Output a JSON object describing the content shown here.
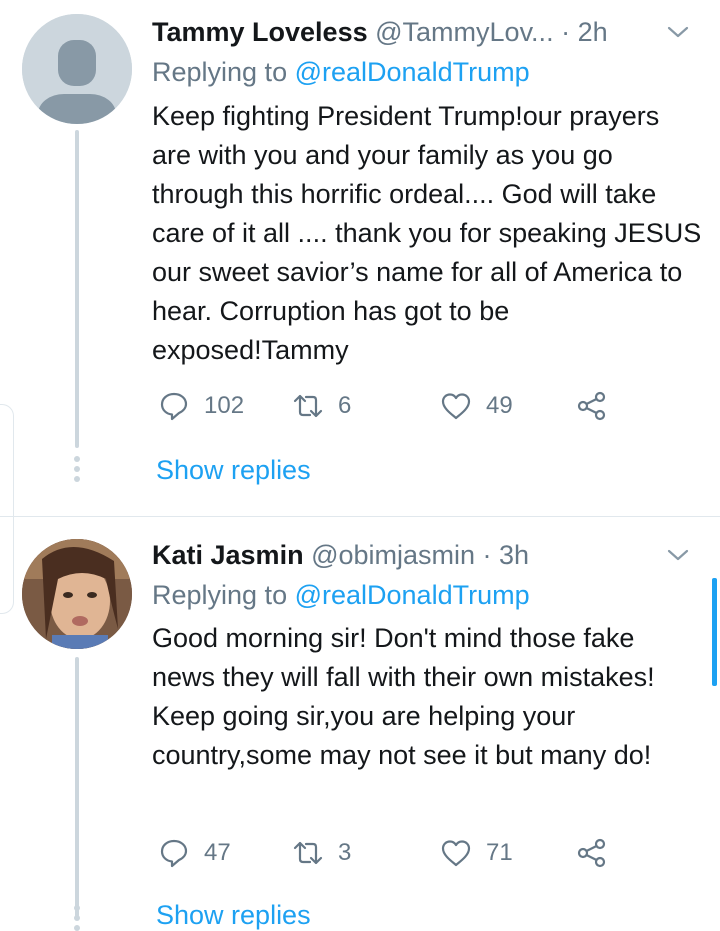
{
  "tweets": [
    {
      "name": "Tammy Loveless",
      "handle": "@TammyLov...",
      "time": "· 2h",
      "replying_prefix": "Replying to ",
      "replying_to": "@realDonaldTrump",
      "text": "Keep fighting President Trump!our prayers are with you and your family as you go through this horrific ordeal.... God will take care of it all .... thank you for speaking JESUS our sweet savior’s name for all of America to hear. Corruption has got to be exposed!Tammy",
      "replies": "102",
      "retweets": "6",
      "likes": "49",
      "show_replies": "Show replies",
      "avatar_icon": "default-avatar-icon"
    },
    {
      "name": "Kati Jasmin",
      "handle": "@obimjasmin",
      "time": "· 3h",
      "replying_prefix": "Replying to ",
      "replying_to": "@realDonaldTrump",
      "text": "Good morning sir! Don't mind those fake news they will fall with their own mistakes! Keep going sir,you are helping your country,some may not see it but many do!",
      "replies": "47",
      "retweets": "3",
      "likes": "71",
      "show_replies": "Show replies",
      "avatar_icon": "profile-photo"
    }
  ],
  "colors": {
    "accent": "#1da1f2",
    "secondary_text": "#657786",
    "primary_text": "#14171a",
    "divider": "#e1e8ed",
    "thread_line": "#ccd6dd"
  }
}
